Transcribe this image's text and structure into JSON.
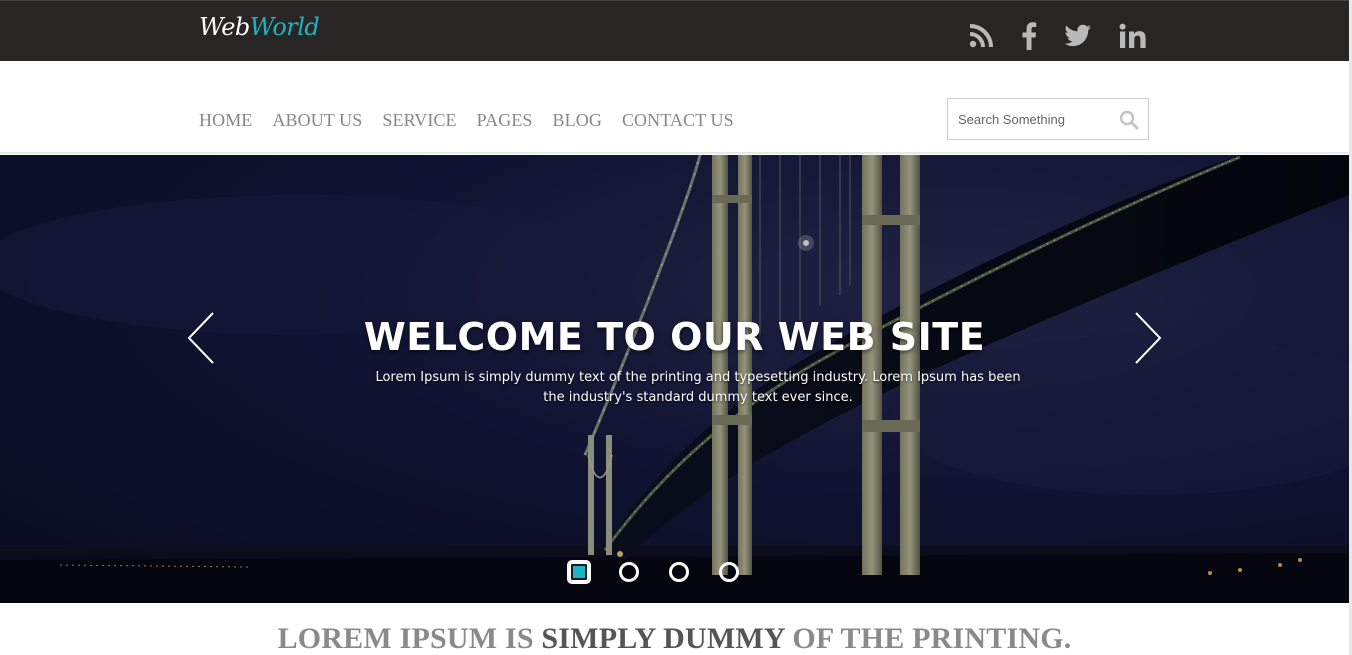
{
  "header": {
    "logo_part1": "Web",
    "logo_part2": "World",
    "social": [
      {
        "icon": "rss-icon"
      },
      {
        "icon": "facebook-icon"
      },
      {
        "icon": "twitter-icon"
      },
      {
        "icon": "linkedin-icon"
      }
    ]
  },
  "nav": {
    "items": [
      "HOME",
      "ABOUT US",
      "SERVICE",
      "PAGES",
      "BLOG",
      "CONTACT US"
    ],
    "search_placeholder": "Search Something",
    "search_icon": "search-icon"
  },
  "hero": {
    "title": "WELCOME TO OUR WEB SITE",
    "text": "Lorem Ipsum is simply dummy text of the printing and typesetting industry. Lorem Ipsum has been the industry's standard dummy text ever since.",
    "prev_icon": "chevron-left-icon",
    "next_icon": "chevron-right-icon",
    "slide_count": 4,
    "active_slide": 1
  },
  "section": {
    "heading_part1": "LOREM IPSUM IS ",
    "heading_part2": "SIMPLY DUMMY",
    "heading_part3": " OF THE PRINTING."
  },
  "colors": {
    "topbar": "#282625",
    "accent": "#1fb3c2",
    "nav_text": "#878787"
  }
}
